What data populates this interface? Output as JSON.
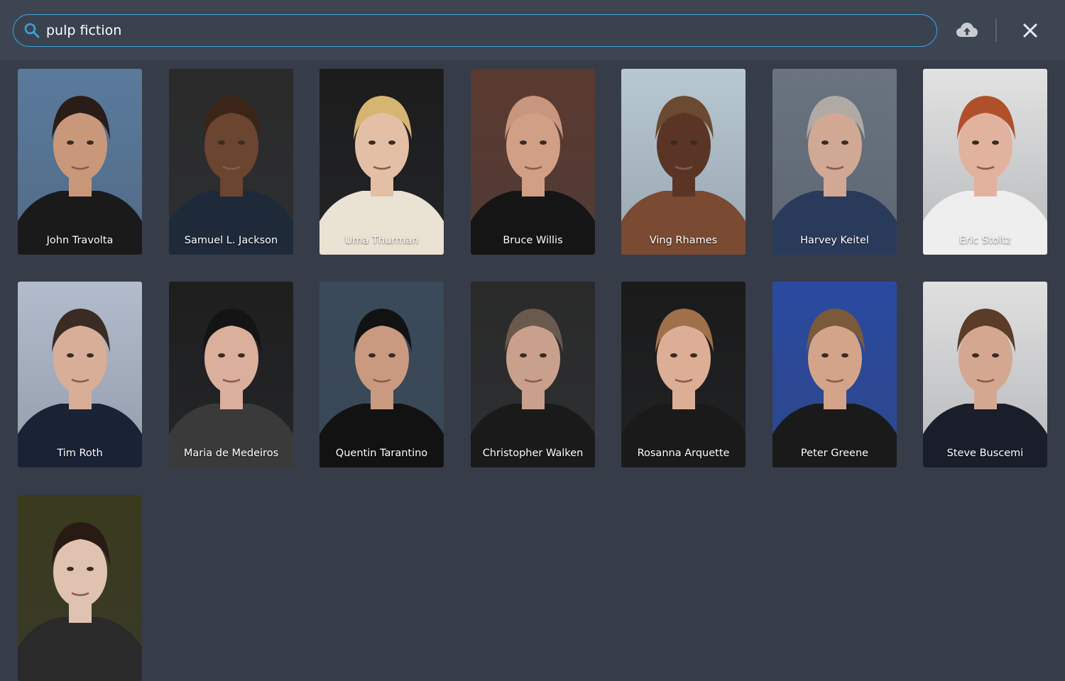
{
  "search": {
    "value": "pulp fiction",
    "accent": "#3aa3d8"
  },
  "toolbar": {
    "upload_icon": "cloud-upload-icon",
    "close_icon": "close-icon"
  },
  "cast": [
    {
      "name": "John Travolta",
      "bg": "#5a7a9c",
      "skin": "#c9987a",
      "hair": "#2a1d17",
      "shirt": "#1a1a1a"
    },
    {
      "name": "Samuel L. Jackson",
      "bg": "#2a2a2a",
      "skin": "#6b4530",
      "hair": "#3a2518",
      "shirt": "#1e2a3a"
    },
    {
      "name": "Uma Thurman",
      "bg": "#1c1c1c",
      "skin": "#e3bfa5",
      "hair": "#d6b571",
      "shirt": "#eae2d2"
    },
    {
      "name": "Bruce Willis",
      "bg": "#5a3a30",
      "skin": "#d09f86",
      "hair": "#c8967e",
      "shirt": "#151515"
    },
    {
      "name": "Ving Rhames",
      "bg": "#b8c8d2",
      "skin": "#5a3526",
      "hair": "#6a4a30",
      "shirt": "#7a4a32"
    },
    {
      "name": "Harvey Keitel",
      "bg": "#6a7480",
      "skin": "#d0a894",
      "hair": "#b0aaa4",
      "shirt": "#2a3a5a"
    },
    {
      "name": "Eric Stoltz",
      "bg": "#e2e2e2",
      "skin": "#e1b39e",
      "hair": "#b0502a",
      "shirt": "#eeeeee"
    },
    {
      "name": "Tim Roth",
      "bg": "#b2bccc",
      "skin": "#d8ae98",
      "hair": "#3a2c22",
      "shirt": "#1a2236"
    },
    {
      "name": "Maria de Medeiros",
      "bg": "#1e1e1e",
      "skin": "#dab09c",
      "hair": "#141414",
      "shirt": "#3a3a3a"
    },
    {
      "name": "Quentin Tarantino",
      "bg": "#3a4a5a",
      "skin": "#c99a80",
      "hair": "#121212",
      "shirt": "#121212"
    },
    {
      "name": "Christopher Walken",
      "bg": "#2a2a2a",
      "skin": "#c8a08c",
      "hair": "#6a5a4e",
      "shirt": "#1a1a1a"
    },
    {
      "name": "Rosanna Arquette",
      "bg": "#1a1a1a",
      "skin": "#dcae96",
      "hair": "#a0704a",
      "shirt": "#1a1a1a"
    },
    {
      "name": "Peter Greene",
      "bg": "#2a4aa0",
      "skin": "#d4a48a",
      "hair": "#7a5a3a",
      "shirt": "#1a1a1a"
    },
    {
      "name": "Steve Buscemi",
      "bg": "#e0e0e0",
      "skin": "#d4a890",
      "hair": "#5a3c28",
      "shirt": "#1a1e2a"
    },
    {
      "name": "",
      "bg": "#3a3a1e",
      "skin": "#e0c2b0",
      "hair": "#2a1a14",
      "shirt": "#2a2a2a"
    }
  ]
}
